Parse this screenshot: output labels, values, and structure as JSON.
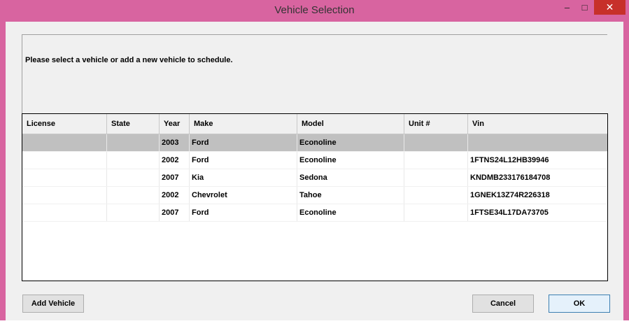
{
  "window": {
    "title": "Vehicle Selection",
    "controls": {
      "minimize": "–",
      "maximize": "□",
      "close": "✕"
    }
  },
  "message": "Please select a vehicle or add a new vehicle to schedule.",
  "grid": {
    "columns": [
      "License",
      "State",
      "Year",
      "Make",
      "Model",
      "Unit #",
      "Vin"
    ],
    "rows": [
      {
        "license": "",
        "state": "",
        "year": "2003",
        "make": "Ford",
        "model": "Econoline",
        "unit": "",
        "vin": ""
      },
      {
        "license": "",
        "state": "",
        "year": "2002",
        "make": "Ford",
        "model": "Econoline",
        "unit": "",
        "vin": "1FTNS24L12HB39946"
      },
      {
        "license": "",
        "state": "",
        "year": "2007",
        "make": "Kia",
        "model": "Sedona",
        "unit": "",
        "vin": "KNDMB233176184708"
      },
      {
        "license": "",
        "state": "",
        "year": "2002",
        "make": "Chevrolet",
        "model": "Tahoe",
        "unit": "",
        "vin": "1GNEK13Z74R226318"
      },
      {
        "license": "",
        "state": "",
        "year": "2007",
        "make": "Ford",
        "model": "Econoline",
        "unit": "",
        "vin": "1FTSE34L17DA73705"
      }
    ],
    "selected_row": 0
  },
  "buttons": {
    "add_vehicle": "Add Vehicle",
    "cancel": "Cancel",
    "ok": "OK"
  },
  "colors": {
    "window_frame": "#d864a0",
    "close_button": "#c7302a",
    "selected_row": "#c0c0c0"
  }
}
